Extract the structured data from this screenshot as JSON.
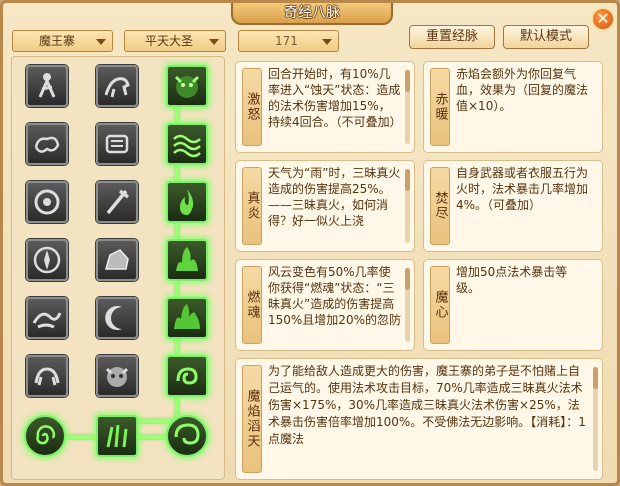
{
  "window": {
    "title": "奇经八脉",
    "close_glyph": "✕"
  },
  "controls": {
    "sect_select": {
      "value": "魔王寨"
    },
    "role_select": {
      "value": "平天大圣"
    },
    "level_select": {
      "value": "171"
    },
    "reset_button": "重置经脉",
    "default_button": "默认模式"
  },
  "skill_grid": {
    "rows": 7,
    "active_path": [
      "col3-row1",
      "col3-row2",
      "col3-row3",
      "col3-row4",
      "col3-row5",
      "col3-row6",
      "col1-row7",
      "col2-row7",
      "col3-row7"
    ],
    "icons": [
      [
        "figure-icon",
        "horse-icon",
        "demon-face-icon"
      ],
      [
        "cloud-swirl-icon",
        "scroll-icon",
        "wave-pattern-icon"
      ],
      [
        "sun-disc-icon",
        "staff-icon",
        "flame-icon"
      ],
      [
        "medallion-icon",
        "rock-icon",
        "fire-burst-icon"
      ],
      [
        "dragon-icon",
        "crescent-icon",
        "inferno-icon"
      ],
      [
        "creature-icon",
        "demon-mask-icon",
        "fire-swirl-icon"
      ],
      [
        "spiral-icon",
        "claw-fire-icon",
        "vortex-icon"
      ]
    ]
  },
  "cards": [
    {
      "name": "激怒",
      "text": "回合开始时，有10%几率进入“蚀天”状态：造成的法术伤害增加15%，持续4回合。（不可叠加）"
    },
    {
      "name": "赤暖",
      "text": "赤焰会额外为你回复气血，效果为（回复的魔法值×10）。"
    },
    {
      "name": "真炎",
      "text": "天气为“雨”时，三昧真火造成的伤害提高25%。——三昧真火，如何消得？好一似火上浇"
    },
    {
      "name": "焚尽",
      "text": "自身武器或者衣服五行为火时，法术暴击几率增加4%。（可叠加）"
    },
    {
      "name": "燃魂",
      "text": "风云变色有50%几率使你获得“燃魂”状态：“三昧真火”造成的伤害提高150%且增加20%的忽防"
    },
    {
      "name": "魔心",
      "text": "增加50点法术暴击等级。"
    },
    {
      "name": "魔焰滔天",
      "text": "为了能给敌人造成更大的伤害，魔王寨的弟子是不怕赌上自己运气的。使用法术攻击目标，70%几率造成三昧真火法术伤害×175%，30%几率造成三昧真火法术伤害×25%，法术暴击伤害倍率增加100%。不受佛法无边影响。【消耗】：1点魔法"
    }
  ],
  "colors": {
    "active_glow": "#8bff6f",
    "title_bar": "#e0a74f",
    "panel_bg": "#f6e7c5"
  }
}
